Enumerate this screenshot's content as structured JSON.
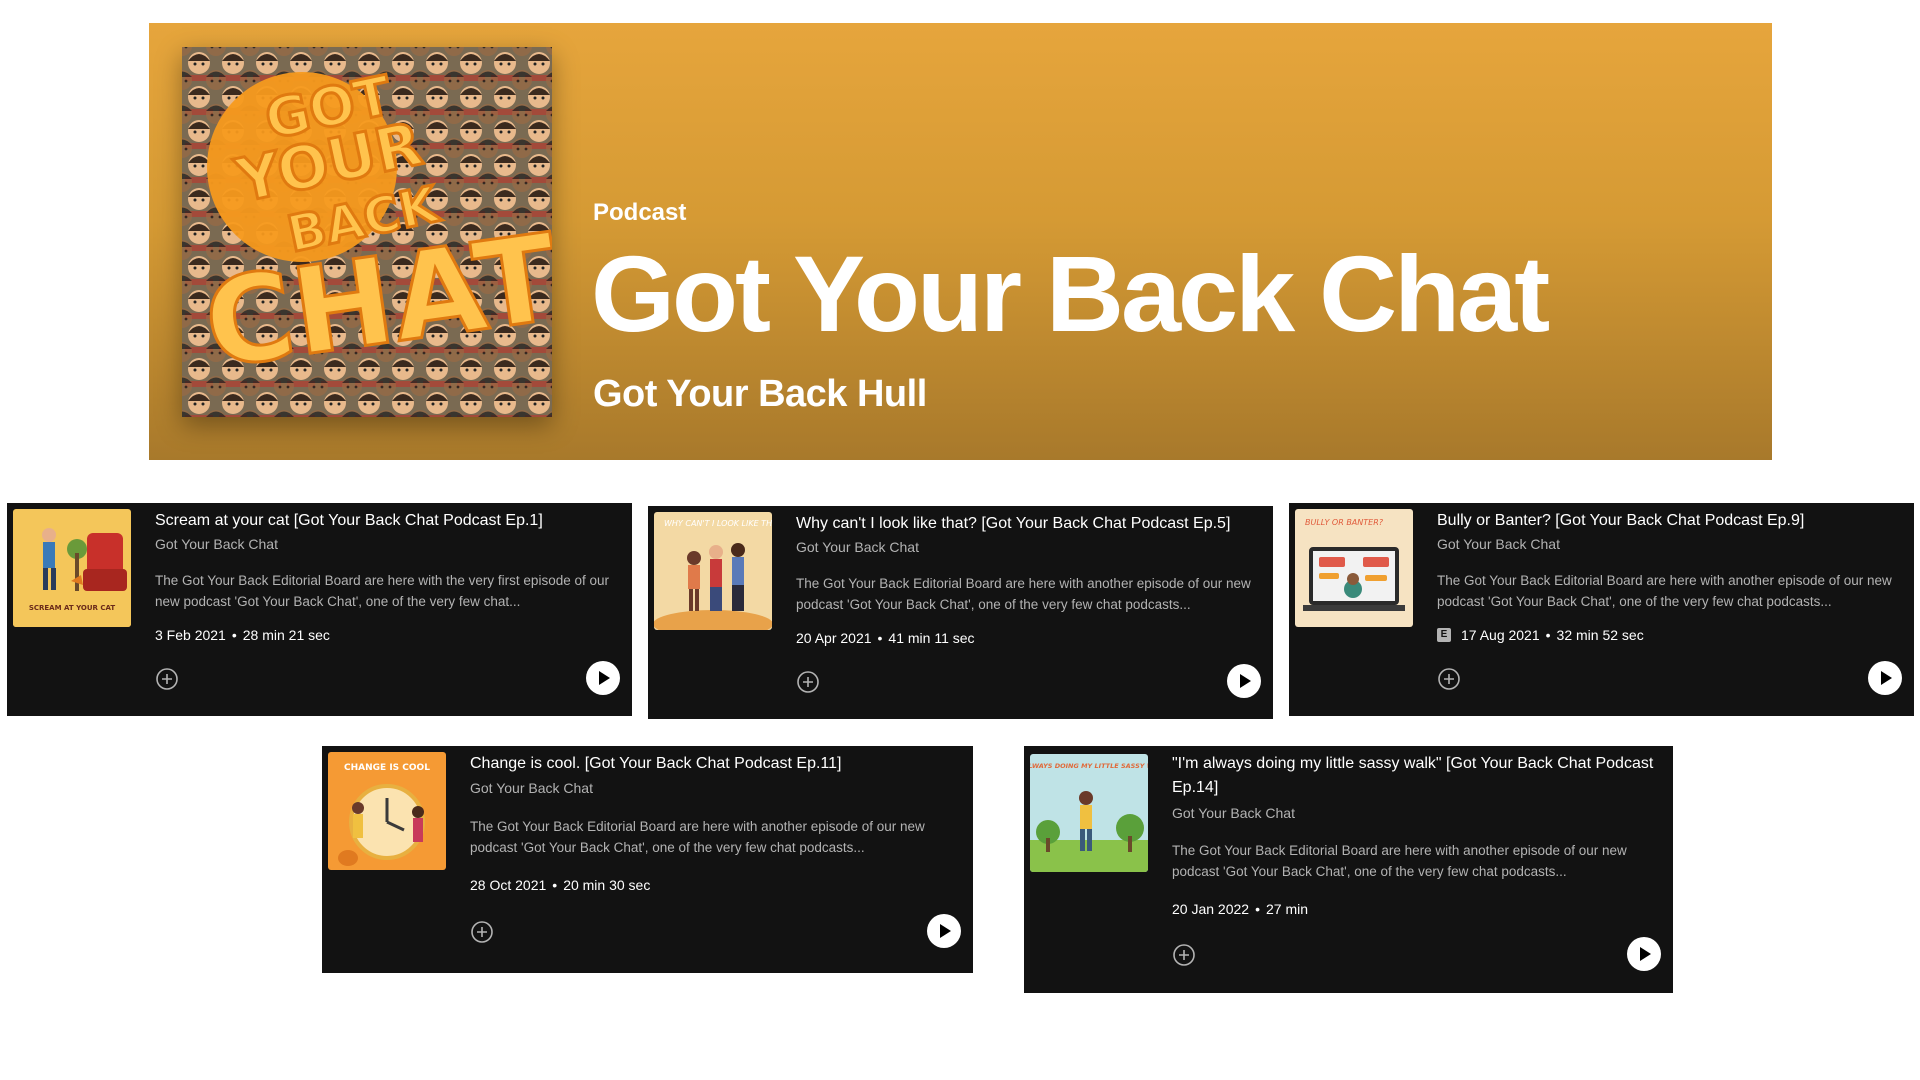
{
  "podcast": {
    "type_label": "Podcast",
    "title": "Got Your Back Chat",
    "author": "Got Your Back Hull",
    "cover_text": [
      "GOT",
      "YOUR",
      "BACK",
      "CHAT"
    ],
    "colors": {
      "banner_top": "#e6a53c",
      "banner_bottom": "#a8792b",
      "card_bg": "#121212",
      "cover_orange": "#f7a531"
    }
  },
  "episodes": [
    {
      "title": "Scream at your cat [Got Your Back Chat Podcast Ep.1]",
      "show": "Got Your Back Chat",
      "description": "The Got Your Back Editorial Board are here with the very first episode of our new podcast 'Got Your Back Chat', one of the very few chat...",
      "date": "3 Feb 2021",
      "duration": "28 min 21 sec",
      "explicit": false,
      "thumb_text": "SCREAM AT YOUR CAT",
      "thumb_color": "#f4c65a"
    },
    {
      "title": "Why can't I look like that? [Got Your Back Chat Podcast Ep.5]",
      "show": "Got Your Back Chat",
      "description": "The Got Your Back Editorial Board are here with another episode of our new podcast 'Got Your Back Chat', one of the very few chat podcasts...",
      "date": "20 Apr 2021",
      "duration": "41 min 11 sec",
      "explicit": false,
      "thumb_text": "WHY CAN'T I LOOK LIKE THAT?",
      "thumb_color": "#f3d9a4"
    },
    {
      "title": "Bully or Banter? [Got Your Back Chat Podcast Ep.9]",
      "show": "Got Your Back Chat",
      "description": "The Got Your Back Editorial Board are here with another episode of our new podcast 'Got Your Back Chat', one of the very few chat podcasts...",
      "date": "17 Aug 2021",
      "duration": "32 min 52 sec",
      "explicit": true,
      "explicit_label": "E",
      "thumb_text": "BULLY OR BANTER?",
      "thumb_color": "#f6e3c2"
    },
    {
      "title": "Change is cool. [Got Your Back Chat Podcast Ep.11]",
      "show": "Got Your Back Chat",
      "description": "The Got Your Back Editorial Board are here with another episode of our new podcast 'Got Your Back Chat', one of the very few chat podcasts...",
      "date": "28 Oct 2021",
      "duration": "20 min 30 sec",
      "explicit": false,
      "thumb_text": "CHANGE IS COOL",
      "thumb_color": "#f59a34"
    },
    {
      "title": "\"I'm always doing my little sassy walk\" [Got Your Back Chat Podcast Ep.14]",
      "show": "Got Your Back Chat",
      "description": "The Got Your Back Editorial Board are here with another episode of our new podcast 'Got Your Back Chat', one of the very few chat podcasts...",
      "date": "20 Jan 2022",
      "duration": "27 min",
      "explicit": false,
      "thumb_text": "I'M ALWAYS DOING MY LITTLE SASSY WALK",
      "thumb_color": "#bfe3e6"
    }
  ],
  "icons": {
    "add": "plus-circle-icon",
    "play": "play-icon"
  }
}
